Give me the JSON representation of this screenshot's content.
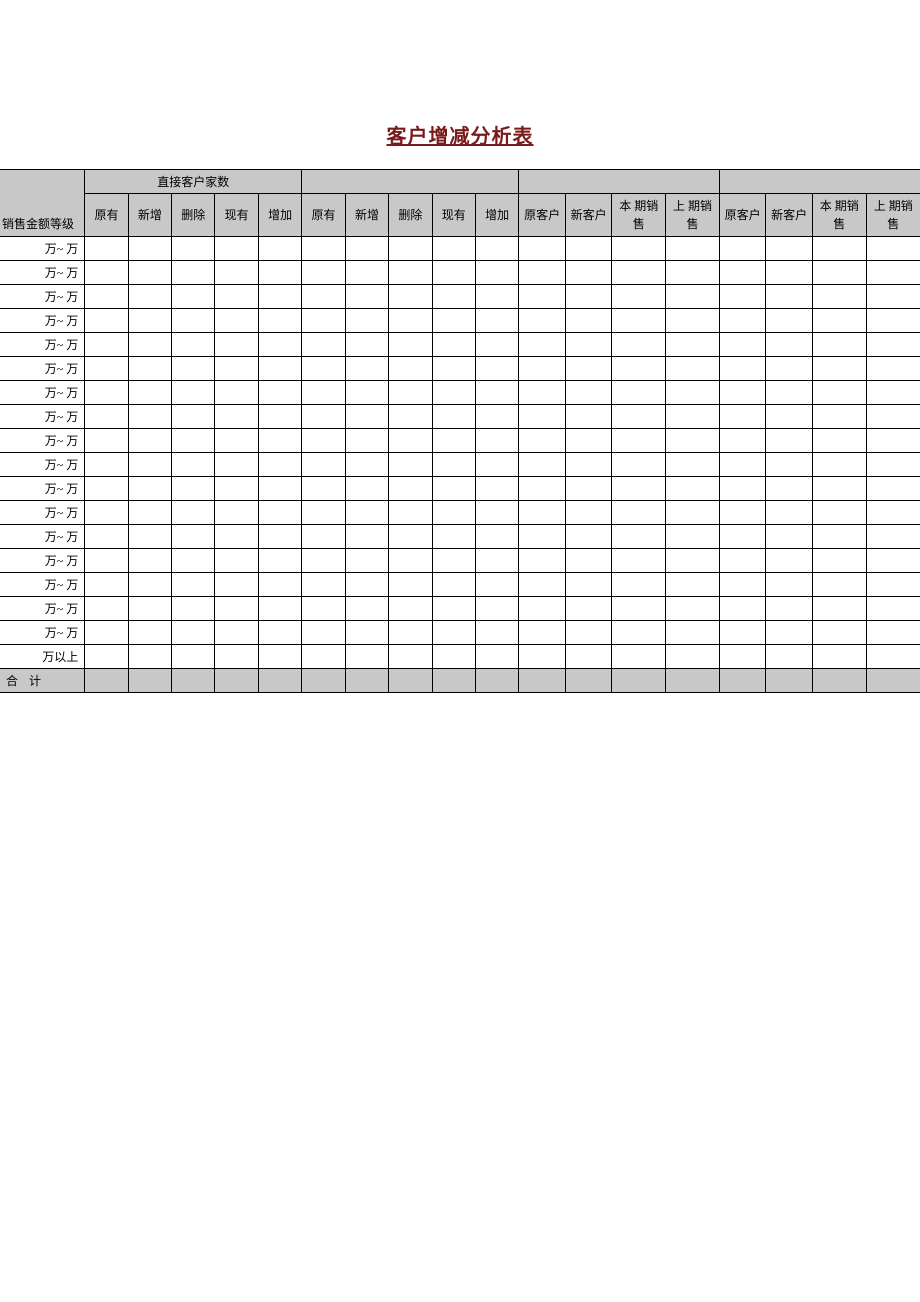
{
  "title": "客户增减分析表",
  "header": {
    "group_direct": "直接客户家数",
    "sales_grade": "销售金额等级",
    "sub1": [
      "原有",
      "新增",
      "删除",
      "现有",
      "增加"
    ],
    "sub2": [
      "原有",
      "新增",
      "删除",
      "现有",
      "增加"
    ],
    "sub3": [
      "原客户",
      "新客户",
      "本 期销 售",
      "上 期销 售"
    ],
    "sub4": [
      "原客户",
      "新客户",
      "本 期销 售",
      "上 期销 售"
    ]
  },
  "rows": [
    {
      "label": "万~  万"
    },
    {
      "label": "万~  万"
    },
    {
      "label": "万~  万"
    },
    {
      "label": "万~  万"
    },
    {
      "label": "万~  万"
    },
    {
      "label": "万~  万"
    },
    {
      "label": "万~  万"
    },
    {
      "label": "万~  万"
    },
    {
      "label": "万~  万"
    },
    {
      "label": "万~  万"
    },
    {
      "label": "万~  万"
    },
    {
      "label": "万~  万"
    },
    {
      "label": "万~  万"
    },
    {
      "label": "万~  万"
    },
    {
      "label": "万~  万"
    },
    {
      "label": "万~  万"
    },
    {
      "label": "万~  万"
    },
    {
      "label": "万以上"
    }
  ],
  "total_label": "合  计"
}
